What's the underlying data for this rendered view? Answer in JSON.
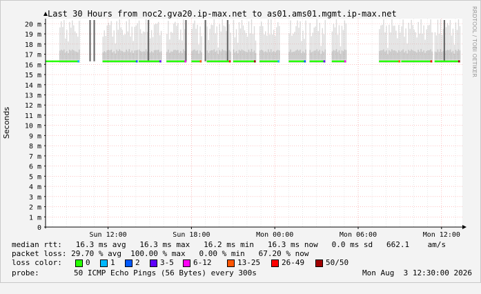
{
  "chart_data": {
    "type": "area",
    "title": "Last 30 Hours from noc2.gva20.ip-max.net to as01.ams01.mgmt.ip-max.net",
    "ylabel": "Seconds",
    "ylim": [
      0,
      20.5
    ],
    "y_ticks": [
      "0",
      "1 m",
      "2 m",
      "3 m",
      "4 m",
      "5 m",
      "6 m",
      "7 m",
      "8 m",
      "9 m",
      "10 m",
      "11 m",
      "12 m",
      "13 m",
      "14 m",
      "15 m",
      "16 m",
      "17 m",
      "18 m",
      "19 m",
      "20 m"
    ],
    "x_ticks": [
      {
        "label": "Sun 12:00",
        "hour": 4.5
      },
      {
        "label": "Sun 18:00",
        "hour": 10.5
      },
      {
        "label": "Mon 00:00",
        "hour": 16.5
      },
      {
        "label": "Mon 06:00",
        "hour": 22.5
      },
      {
        "label": "Mon 12:00",
        "hour": 28.5
      }
    ],
    "grid": true,
    "side_label": "RRDTOOL / TOBI OETIKER",
    "series": [
      {
        "name": "median rtt",
        "value_ms": 16.3,
        "unit": "ms",
        "segments": [
          [
            0.0,
            2.4
          ],
          [
            4.1,
            6.6
          ],
          [
            6.7,
            8.3
          ],
          [
            8.7,
            10.1
          ],
          [
            10.5,
            11.2
          ],
          [
            11.6,
            13.3
          ],
          [
            13.5,
            15.1
          ],
          [
            15.4,
            16.8
          ],
          [
            17.5,
            18.7
          ],
          [
            19.0,
            20.1
          ],
          [
            20.6,
            21.6
          ],
          [
            24.0,
            25.5
          ],
          [
            25.6,
            27.8
          ],
          [
            28.0,
            29.8
          ]
        ],
        "sd_segments": [
          [
            1.0,
            2.4
          ],
          [
            4.1,
            6.6
          ],
          [
            6.7,
            8.3
          ],
          [
            8.7,
            10.1
          ],
          [
            10.5,
            11.2
          ],
          [
            11.6,
            13.3
          ],
          [
            13.5,
            15.1
          ],
          [
            15.4,
            16.8
          ],
          [
            17.5,
            18.7
          ],
          [
            19.0,
            20.1
          ],
          [
            20.6,
            21.6
          ],
          [
            24.0,
            25.5
          ],
          [
            25.6,
            27.8
          ],
          [
            28.0,
            29.8
          ]
        ],
        "loss_spikes_hour": [
          3.2,
          3.5,
          7.4,
          10.1,
          11.5,
          13.1,
          28.7
        ]
      }
    ]
  },
  "stats": {
    "median_rtt": "median rtt:   16.3 ms avg   16.3 ms max   16.2 ms min   16.3 ms now   0.0 ms sd   662.1    am/s",
    "packet_loss": "packet loss: 29.70 % avg  100.00 % max   0.00 % min   67.20 % now",
    "loss_color_label": "loss color:",
    "probe_label": "probe:",
    "probe_text": "50 ICMP Echo Pings (56 Bytes) every 300s",
    "timestamp": "Mon Aug  3 12:30:00 2026"
  },
  "loss_legend": [
    {
      "label": "0",
      "color": "#26ff00"
    },
    {
      "label": "1",
      "color": "#00b8ff"
    },
    {
      "label": "2",
      "color": "#0059ff"
    },
    {
      "label": "3-5",
      "color": "#5e00ff"
    },
    {
      "label": "6-12",
      "color": "#ff00f4"
    },
    {
      "label": "13-25",
      "color": "#ff5500"
    },
    {
      "label": "26-49",
      "color": "#ff0000"
    },
    {
      "label": "50/50",
      "color": "#a10000"
    }
  ]
}
